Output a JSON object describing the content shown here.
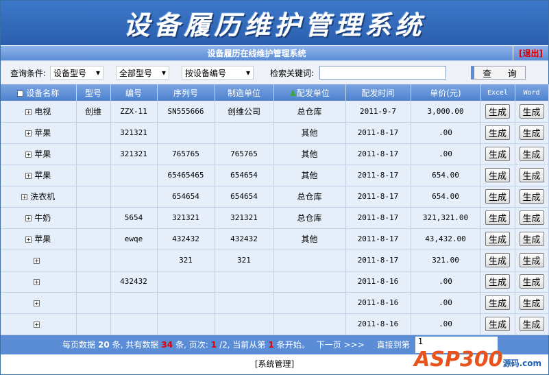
{
  "banner_title": "设备履历维护管理系统",
  "subheader": {
    "title": "设备履历在线维护管理系统",
    "logout": "[退出]"
  },
  "query": {
    "label": "查询条件:",
    "select1": "设备型号",
    "select2": "全部型号",
    "select3": "按设备编号",
    "keyword_label": "检索关键词:",
    "keyword_value": "",
    "button": "查 询"
  },
  "columns": [
    "设备名称",
    "型号",
    "编号",
    "序列号",
    "制造单位",
    "配发单位",
    "配发时间",
    "单价(元)",
    "Excel",
    "Word"
  ],
  "gen_label": "生成",
  "rows": [
    {
      "name": "电视",
      "model": "创维",
      "code": "ZZX-11",
      "serial": "SN555666",
      "maker": "创维公司",
      "unit": "总仓库",
      "date": "2011-9-7",
      "price": "3,000.00"
    },
    {
      "name": "苹果",
      "model": "",
      "code": "321321",
      "serial": "",
      "maker": "",
      "unit": "其他",
      "date": "2011-8-17",
      "price": ".00"
    },
    {
      "name": "苹果",
      "model": "",
      "code": "321321",
      "serial": "765765",
      "maker": "765765",
      "unit": "其他",
      "date": "2011-8-17",
      "price": ".00"
    },
    {
      "name": "苹果",
      "model": "",
      "code": "",
      "serial": "65465465",
      "maker": "654654",
      "unit": "其他",
      "date": "2011-8-17",
      "price": "654.00"
    },
    {
      "name": "洗衣机",
      "model": "",
      "code": "",
      "serial": "654654",
      "maker": "654654",
      "unit": "总仓库",
      "date": "2011-8-17",
      "price": "654.00"
    },
    {
      "name": "牛奶",
      "model": "",
      "code": "5654",
      "serial": "321321",
      "maker": "321321",
      "unit": "总仓库",
      "date": "2011-8-17",
      "price": "321,321.00"
    },
    {
      "name": "苹果",
      "model": "",
      "code": "ewqe",
      "serial": "432432",
      "maker": "432432",
      "unit": "其他",
      "date": "2011-8-17",
      "price": "43,432.00"
    },
    {
      "name": "",
      "model": "",
      "code": "",
      "serial": "321",
      "maker": "321",
      "unit": "",
      "date": "2011-8-17",
      "price": "321.00"
    },
    {
      "name": "",
      "model": "",
      "code": "432432",
      "serial": "",
      "maker": "",
      "unit": "",
      "date": "2011-8-16",
      "price": ".00"
    },
    {
      "name": "",
      "model": "",
      "code": "",
      "serial": "",
      "maker": "",
      "unit": "",
      "date": "2011-8-16",
      "price": ".00"
    },
    {
      "name": "",
      "model": "",
      "code": "",
      "serial": "",
      "maker": "",
      "unit": "",
      "date": "2011-8-16",
      "price": ".00"
    }
  ],
  "pager": {
    "t1": "每页数据",
    "per_page": "20",
    "t2": "条, 共有数据",
    "total": "34",
    "t3": "条, 页次:",
    "page": "1",
    "t4": "/2, 当前从第",
    "start": "1",
    "t5": "条开始。",
    "next": "下一页 >>>",
    "jump_label": "直接到第",
    "jump_value": "1"
  },
  "footer": "[系统管理]",
  "logo": "ASP300 源码 .com"
}
